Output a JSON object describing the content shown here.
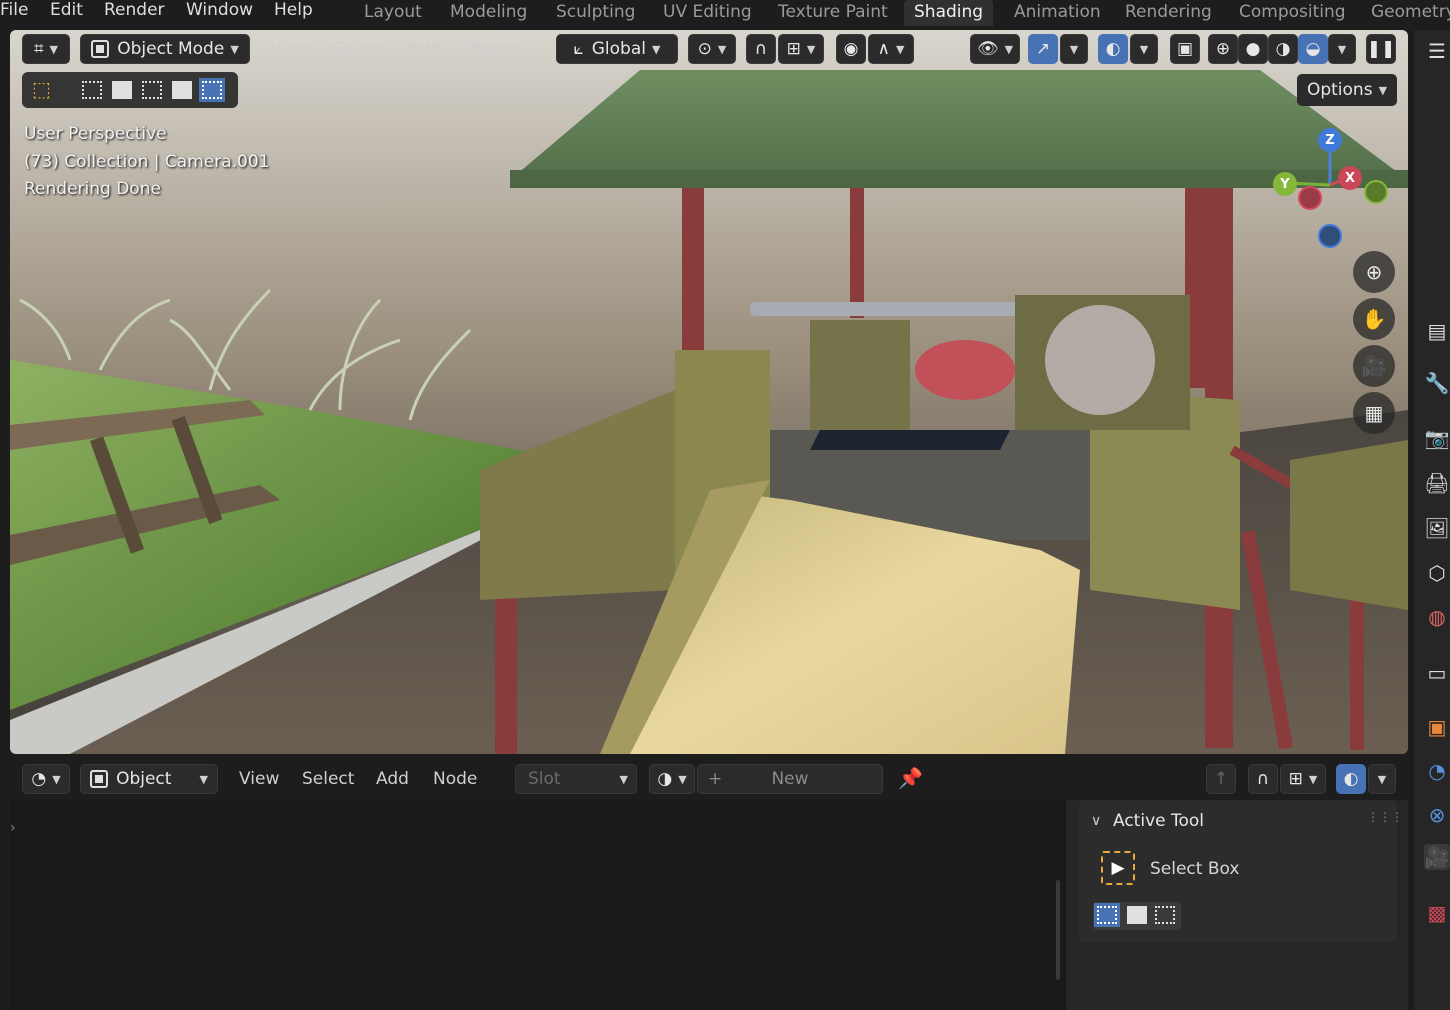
{
  "menu": {
    "file": "File",
    "edit": "Edit",
    "render": "Render",
    "window": "Window",
    "help": "Help"
  },
  "workspaces": [
    "Layout",
    "Modeling",
    "Sculpting",
    "UV Editing",
    "Texture Paint",
    "Shading",
    "Animation",
    "Rendering",
    "Compositing",
    "Geometry"
  ],
  "active_workspace": "Shading",
  "viewport": {
    "mode": "Object Mode",
    "menus": [
      "View",
      "Select",
      "Add",
      "Object"
    ],
    "orientation": "Global",
    "options_label": "Options",
    "overlay_lines": [
      "User Perspective",
      "(73) Collection | Camera.001",
      "Rendering Done"
    ],
    "gizmo_axes": {
      "z": "Z",
      "y": "Y",
      "x": "X"
    }
  },
  "node_editor": {
    "mode": "Object",
    "menus": [
      "View",
      "Select",
      "Add",
      "Node"
    ],
    "slot_placeholder": "Slot",
    "new_label": "New"
  },
  "active_tool": {
    "panel_title": "Active Tool",
    "tool_name": "Select Box"
  },
  "colors": {
    "accent": "#4772b3",
    "header_bg": "#1d1d1d",
    "panel_bg": "#2c2c2c"
  }
}
